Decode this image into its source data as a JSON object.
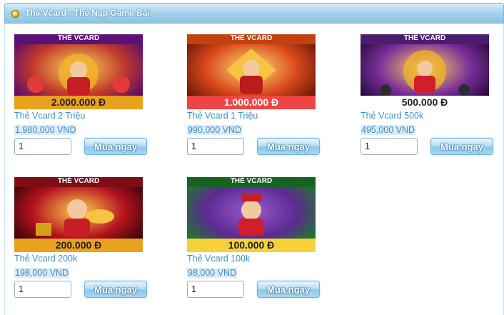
{
  "header": {
    "title": "Thẻ Vcard - Thẻ Nạp Game Bài",
    "icon": "coin-icon"
  },
  "products": [
    {
      "name": "Thẻ Vcard 2 Triệu",
      "price": "1,980,000 VND",
      "quantity": "1",
      "buy_label": "Mua ngay",
      "card_brand": "THẺ VCARD",
      "card_amount": "2.000.000 Đ",
      "theme": "#b0151c"
    },
    {
      "name": "Thẻ Vcard 1 Triệu",
      "price": "990,000 VND",
      "quantity": "1",
      "buy_label": "Mua ngay",
      "card_brand": "THẺ VCARD",
      "card_amount": "1.000.000 Đ",
      "theme": "#d9471a"
    },
    {
      "name": "Thẻ Vcard 500k",
      "price": "495,000 VND",
      "quantity": "1",
      "buy_label": "Mua ngay",
      "card_brand": "THẺ VCARD",
      "card_amount": "500.000 Đ",
      "theme": "#7a2e9a"
    },
    {
      "name": "Thẻ Vcard 200k",
      "price": "198,000 VND",
      "quantity": "1",
      "buy_label": "Mua ngay",
      "card_brand": "THẺ VCARD",
      "card_amount": "200.000 Đ",
      "theme": "#b3121e"
    },
    {
      "name": "Thẻ Vcard 100k",
      "price": "98,000 VND",
      "quantity": "1",
      "buy_label": "Mua ngay",
      "card_brand": "THẺ VCARD",
      "card_amount": "100.000 Đ",
      "theme": "#1c7a2a"
    }
  ]
}
